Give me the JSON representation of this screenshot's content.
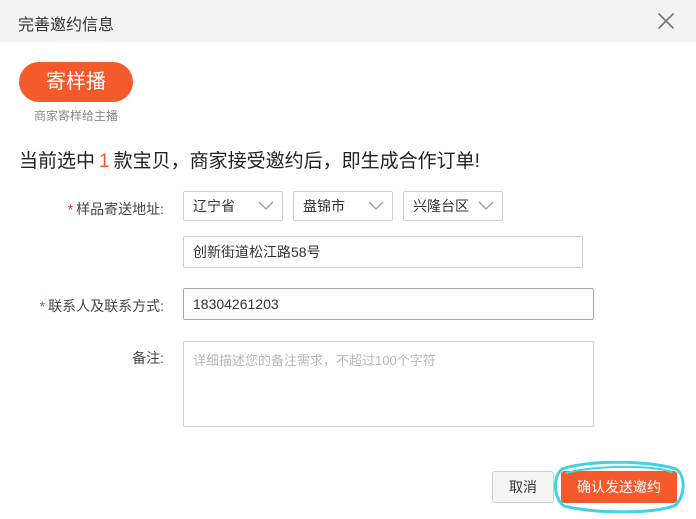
{
  "dialog": {
    "title": "完善邀约信息",
    "close_icon": "close-icon"
  },
  "sample": {
    "button_label": "寄样播",
    "subtitle": "商家寄样给主播"
  },
  "summary": {
    "prefix": "当前选中",
    "count": "1",
    "suffix": "款宝贝，商家接受邀约后，即生成合作订单!"
  },
  "form": {
    "address": {
      "label": "样品寄送地址:",
      "province": "辽宁省",
      "city": "盘锦市",
      "district": "兴隆台区",
      "street": "创新街道松江路58号"
    },
    "contact": {
      "label": "联系人及联系方式:",
      "value": "18304261203"
    },
    "note": {
      "label": "备注:",
      "placeholder": "详细描述您的备注需求，不超过100个字符"
    },
    "required_mark": "*"
  },
  "actions": {
    "cancel_label": "取消",
    "confirm_label": "确认发送邀约"
  },
  "colors": {
    "accent": "#f55a2d",
    "required": "#e4393c",
    "highlight": "#3fd3e6"
  }
}
